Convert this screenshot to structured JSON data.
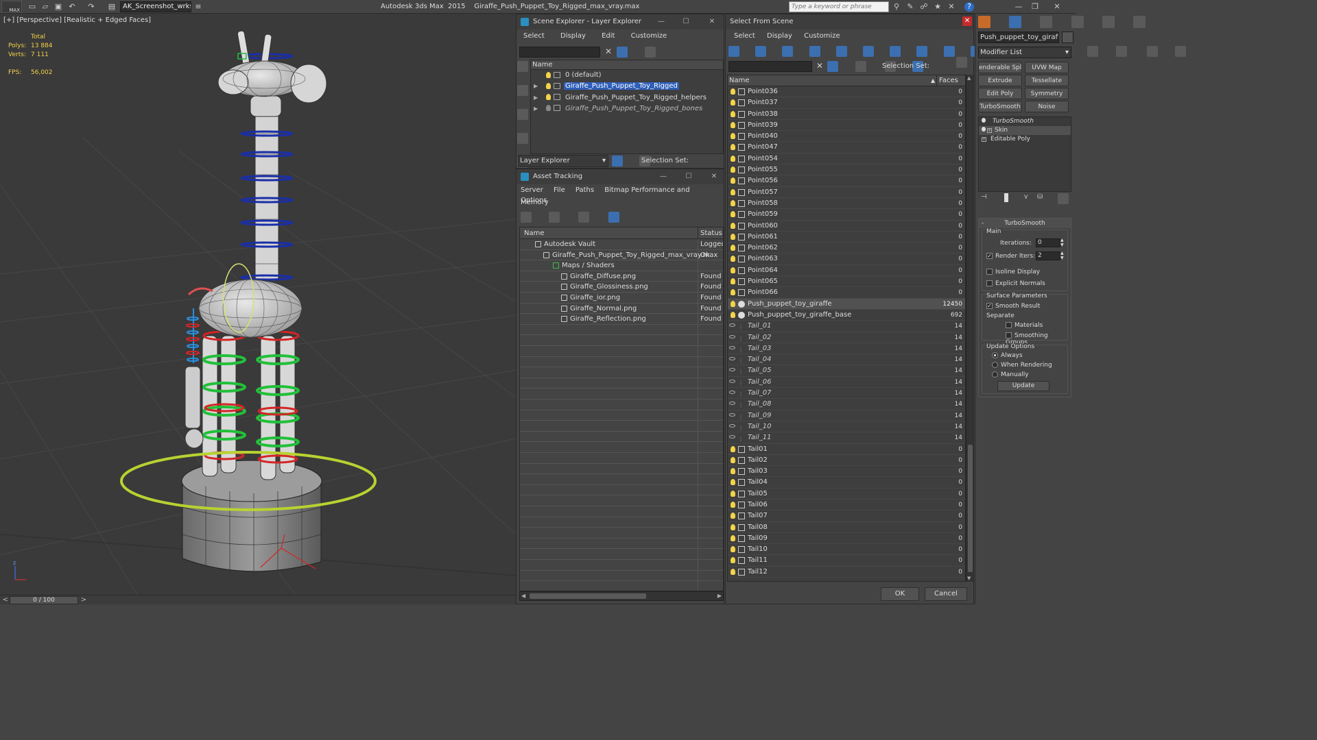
{
  "app": {
    "title": "Autodesk 3ds Max  2015    Giraffe_Push_Puppet_Toy_Rigged_max_vray.max",
    "workspace": "AK_Screenshot_wrksp",
    "search_placeholder": "Type a keyword or phrase",
    "logo": "MAX"
  },
  "viewport": {
    "label": "[+] [Perspective] [Realistic + Edged Faces]",
    "stats_total": "Total",
    "polys_label": "Polys:",
    "polys_value": "13 884",
    "verts_label": "Verts:",
    "verts_value": "7 111",
    "fps_label": "FPS:",
    "fps_value": "56,002",
    "time_slider": "0 / 100"
  },
  "scene_explorer": {
    "title": "Scene Explorer - Layer Explorer",
    "menu": [
      "Select",
      "Display",
      "Edit",
      "Customize"
    ],
    "col_name": "Name",
    "layers": [
      {
        "name": "0 (default)",
        "selected": false,
        "italic": false,
        "light": true
      },
      {
        "name": "Giraffe_Push_Puppet_Toy_Rigged",
        "selected": true,
        "italic": false,
        "light": true
      },
      {
        "name": "Giraffe_Push_Puppet_Toy_Rigged_helpers",
        "selected": false,
        "italic": false,
        "light": true
      },
      {
        "name": "Giraffe_Push_Puppet_Toy_Rigged_bones",
        "selected": false,
        "italic": true,
        "light": false
      }
    ],
    "footer_mode": "Layer Explorer",
    "selection_set": "Selection Set:"
  },
  "asset_tracking": {
    "title": "Asset Tracking",
    "menu": [
      "Server",
      "File",
      "Paths",
      "Bitmap Performance and Memory"
    ],
    "menu2": "Options",
    "col_name": "Name",
    "col_status": "Status",
    "rows": [
      {
        "name": "Autodesk Vault",
        "status": "Logged",
        "indent": 0
      },
      {
        "name": "Giraffe_Push_Puppet_Toy_Rigged_max_vray.max",
        "status": "Ok",
        "indent": 1
      },
      {
        "name": "Maps / Shaders",
        "status": "",
        "indent": 2
      },
      {
        "name": "Giraffe_Diffuse.png",
        "status": "Found",
        "indent": 3
      },
      {
        "name": "Giraffe_Glossiness.png",
        "status": "Found",
        "indent": 3
      },
      {
        "name": "Giraffe_ior.png",
        "status": "Found",
        "indent": 3
      },
      {
        "name": "Giraffe_Normal.png",
        "status": "Found",
        "indent": 3
      },
      {
        "name": "Giraffe_Reflection.png",
        "status": "Found",
        "indent": 3
      }
    ]
  },
  "select_from_scene": {
    "title": "Select From Scene",
    "menu": [
      "Select",
      "Display",
      "Customize"
    ],
    "selection_set": "Selection Set:",
    "col_name": "Name",
    "col_faces": "Faces",
    "items": [
      {
        "name": "Point036",
        "faces": "0",
        "kind": "helper"
      },
      {
        "name": "Point037",
        "faces": "0",
        "kind": "helper"
      },
      {
        "name": "Point038",
        "faces": "0",
        "kind": "helper"
      },
      {
        "name": "Point039",
        "faces": "0",
        "kind": "helper"
      },
      {
        "name": "Point040",
        "faces": "0",
        "kind": "helper"
      },
      {
        "name": "Point047",
        "faces": "0",
        "kind": "helper"
      },
      {
        "name": "Point054",
        "faces": "0",
        "kind": "helper"
      },
      {
        "name": "Point055",
        "faces": "0",
        "kind": "helper"
      },
      {
        "name": "Point056",
        "faces": "0",
        "kind": "helper"
      },
      {
        "name": "Point057",
        "faces": "0",
        "kind": "helper"
      },
      {
        "name": "Point058",
        "faces": "0",
        "kind": "helper"
      },
      {
        "name": "Point059",
        "faces": "0",
        "kind": "helper"
      },
      {
        "name": "Point060",
        "faces": "0",
        "kind": "helper"
      },
      {
        "name": "Point061",
        "faces": "0",
        "kind": "helper"
      },
      {
        "name": "Point062",
        "faces": "0",
        "kind": "helper"
      },
      {
        "name": "Point063",
        "faces": "0",
        "kind": "helper"
      },
      {
        "name": "Point064",
        "faces": "0",
        "kind": "helper"
      },
      {
        "name": "Point065",
        "faces": "0",
        "kind": "helper"
      },
      {
        "name": "Point066",
        "faces": "0",
        "kind": "helper"
      },
      {
        "name": "Push_puppet_toy_giraffe",
        "faces": "12450",
        "kind": "geometry",
        "selected": true
      },
      {
        "name": "Push_puppet_toy_giraffe_base",
        "faces": "692",
        "kind": "geometry"
      },
      {
        "name": "Tail_01",
        "faces": "14",
        "kind": "bone"
      },
      {
        "name": "Tail_02",
        "faces": "14",
        "kind": "bone"
      },
      {
        "name": "Tail_03",
        "faces": "14",
        "kind": "bone"
      },
      {
        "name": "Tail_04",
        "faces": "14",
        "kind": "bone"
      },
      {
        "name": "Tail_05",
        "faces": "14",
        "kind": "bone"
      },
      {
        "name": "Tail_06",
        "faces": "14",
        "kind": "bone"
      },
      {
        "name": "Tail_07",
        "faces": "14",
        "kind": "bone"
      },
      {
        "name": "Tail_08",
        "faces": "14",
        "kind": "bone"
      },
      {
        "name": "Tail_09",
        "faces": "14",
        "kind": "bone"
      },
      {
        "name": "Tail_10",
        "faces": "14",
        "kind": "bone"
      },
      {
        "name": "Tail_11",
        "faces": "14",
        "kind": "bone"
      },
      {
        "name": "Tail01",
        "faces": "0",
        "kind": "shape"
      },
      {
        "name": "Tail02",
        "faces": "0",
        "kind": "shape"
      },
      {
        "name": "Tail03",
        "faces": "0",
        "kind": "shape"
      },
      {
        "name": "Tail04",
        "faces": "0",
        "kind": "shape"
      },
      {
        "name": "Tail05",
        "faces": "0",
        "kind": "shape"
      },
      {
        "name": "Tail06",
        "faces": "0",
        "kind": "shape"
      },
      {
        "name": "Tail07",
        "faces": "0",
        "kind": "shape"
      },
      {
        "name": "Tail08",
        "faces": "0",
        "kind": "shape"
      },
      {
        "name": "Tail09",
        "faces": "0",
        "kind": "shape"
      },
      {
        "name": "Tail10",
        "faces": "0",
        "kind": "shape"
      },
      {
        "name": "Tail11",
        "faces": "0",
        "kind": "shape"
      },
      {
        "name": "Tail12",
        "faces": "0",
        "kind": "shape"
      }
    ],
    "ok_label": "OK",
    "cancel_label": "Cancel"
  },
  "modify_panel": {
    "object_name": "Push_puppet_toy_giraffe",
    "modifier_list": "Modifier List",
    "buttons": [
      "enderable Spli",
      "UVW Map",
      "Extrude",
      "Tessellate",
      "Edit Poly",
      "Symmetry",
      "TurboSmooth",
      "Noise"
    ],
    "stack": [
      "TurboSmooth",
      "Skin",
      "Editable Poly"
    ],
    "rollout_title": "TurboSmooth",
    "main_label": "Main",
    "iterations_label": "Iterations:",
    "iterations_value": "0",
    "render_iters_label": "Render Iters:",
    "render_iters_value": "2",
    "render_iters_checked": true,
    "isoline_label": "Isoline Display",
    "explicit_normals_label": "Explicit Normals",
    "surface_params_label": "Surface Parameters",
    "smooth_result_label": "Smooth Result",
    "separate_label": "Separate",
    "materials_label": "Materials",
    "smoothing_groups_label": "Smoothing Groups",
    "update_options_label": "Update Options",
    "always_label": "Always",
    "when_rendering_label": "When Rendering",
    "manually_label": "Manually",
    "update_button": "Update"
  },
  "colors": {
    "selection": "#2f5fb8",
    "accent_yellow": "#f2d349",
    "viewport_bg": "#3a3a3a",
    "green_helper": "#22c03a",
    "red_helper": "#d42525",
    "blue_helper": "#1a2ea8",
    "yellow_green": "#b8d230"
  }
}
